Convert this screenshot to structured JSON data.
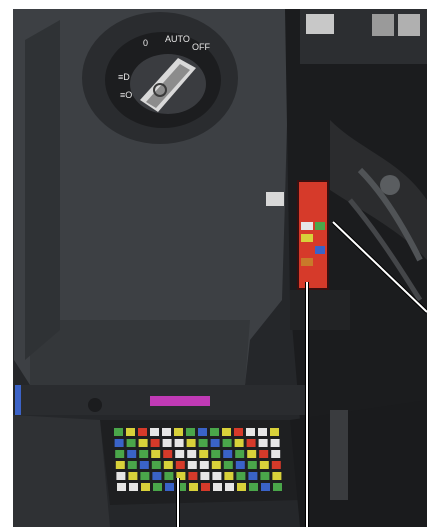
{
  "photo": {
    "subject": "vehicle dashboard lower panel",
    "light_switch": {
      "labels": [
        "0",
        "AUTO",
        "≡D",
        "≡O",
        "OFF"
      ]
    },
    "fuse_boxes": {
      "count": 2,
      "colors": {
        "red_fuse": "#d63a2a",
        "yellow_fuse": "#d8d13a",
        "green_fuse": "#4aa64a",
        "blue_fuse": "#3a63c8",
        "white_fuse": "#e6e6e6"
      }
    },
    "leader_lines": 3,
    "colors": {
      "panel_dark": "#2e3033",
      "panel_mid": "#3b3e42",
      "panel_light": "#4a4e53",
      "frame": "#ffffff",
      "accent_magenta": "#c03ab5",
      "accent_blue": "#3c63c7"
    }
  }
}
